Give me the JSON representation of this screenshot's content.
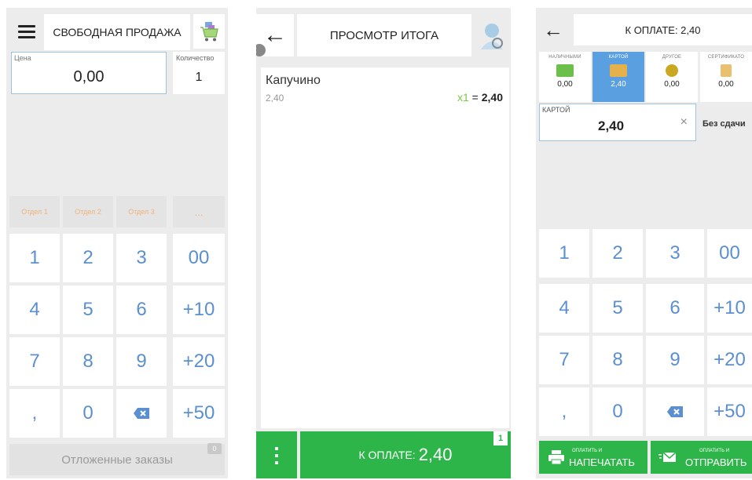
{
  "screen1": {
    "title": "СВОБОДНАЯ ПРОДАЖА",
    "price_label": "Цена",
    "price_value": "0,00",
    "qty_label": "Количество",
    "qty_value": "1",
    "departments": [
      "Отдел 1",
      "Отдел 2",
      "Отдел 3",
      "..."
    ],
    "keys": [
      "1",
      "2",
      "3",
      "00",
      "4",
      "5",
      "6",
      "+10",
      "7",
      "8",
      "9",
      "+20",
      ",",
      "0",
      "⌫",
      "+50"
    ],
    "postponed_label": "Отложенные заказы",
    "postponed_count": "0"
  },
  "screen2": {
    "title": "ПРОСМОТР ИТОГА",
    "item": {
      "name": "Капучино",
      "price": "2,40",
      "qty": "x1",
      "eq": "=",
      "total": "2,40"
    },
    "pay_label": "К ОПЛАТЕ:",
    "pay_amount": "2,40",
    "count_badge": "1",
    "more_glyph": "⋮"
  },
  "screen3": {
    "title": "К ОПЛАТЕ: 2,40",
    "tabs": [
      {
        "label": "НАЛИЧНЫМИ",
        "value": "0,00",
        "icon": "cash-icon",
        "color": "#6bbf4a"
      },
      {
        "label": "КАРТОЙ",
        "value": "2,40",
        "icon": "card-icon",
        "color": "#e6b04a"
      },
      {
        "label": "ДРУГОЕ",
        "value": "0,00",
        "icon": "star-coin-icon",
        "color": "#c9a820"
      },
      {
        "label": "СЕРТИФИКАТО",
        "value": "0,00",
        "icon": "certificate-icon",
        "color": "#e9c070"
      }
    ],
    "field_label": "КАРТОЙ",
    "field_value": "2,40",
    "clear_glyph": "×",
    "no_change": "Без сдачи",
    "keys": [
      "1",
      "2",
      "3",
      "00",
      "4",
      "5",
      "6",
      "+10",
      "7",
      "8",
      "9",
      "+20",
      ",",
      "0",
      "⌫",
      "+50"
    ],
    "pay_print_small": "ОПЛАТИТЬ И",
    "pay_print_large": "НАПЕЧАТАТЬ",
    "pay_send_small": "ОПЛАТИТЬ И",
    "pay_send_large": "ОТПРАВИТЬ"
  },
  "colors": {
    "accent_green": "#2eb54a",
    "key_blue": "#5b8fd0",
    "active_tab": "#5aa0e0",
    "dept_text": "#f2b27a"
  }
}
